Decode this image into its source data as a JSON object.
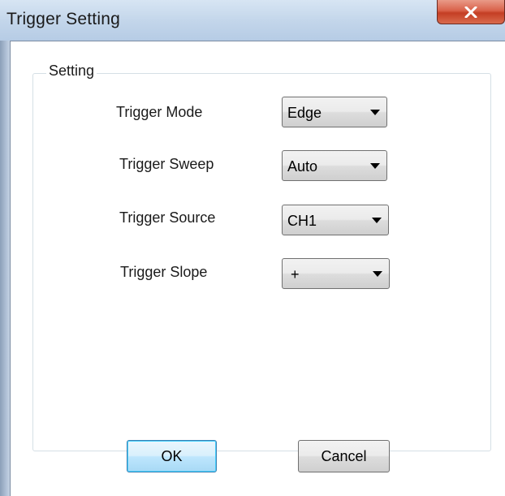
{
  "window": {
    "title": "Trigger Setting",
    "close_icon": "close-icon"
  },
  "group": {
    "label": "Setting"
  },
  "fields": [
    {
      "label": "Trigger Mode",
      "value": "Edge"
    },
    {
      "label": "Trigger Sweep",
      "value": "Auto"
    },
    {
      "label": "Trigger Source",
      "value": "CH1"
    },
    {
      "label": "Trigger Slope",
      "value": "+"
    }
  ],
  "buttons": {
    "ok_label": "OK",
    "cancel_label": "Cancel"
  },
  "colors": {
    "close_button": "#d9624a",
    "default_button_border": "#3c7fb1"
  }
}
